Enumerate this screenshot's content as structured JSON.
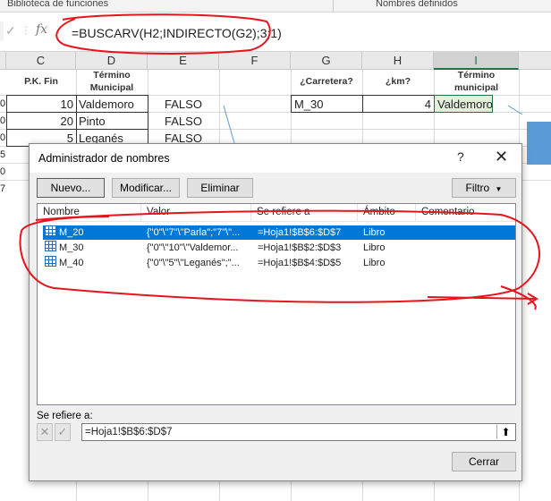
{
  "ribbon": {
    "group1": "Biblioteca de funciones",
    "group2": "Nombres definidos"
  },
  "formula_bar": {
    "cancel_icon": "x-icon",
    "confirm_icon": "check-icon",
    "fx": "fx",
    "formula": "=BUSCARV(H2;INDIRECTO(G2);3;1)"
  },
  "columns": [
    "C",
    "D",
    "E",
    "F",
    "G",
    "H",
    "I"
  ],
  "headers": {
    "c": "P.K. Fin",
    "d": "Término Municipal",
    "g": "¿Carretera?",
    "h": "¿km?",
    "i": "Término municipal"
  },
  "rows": [
    {
      "c": "10",
      "d": "Valdemoro",
      "e": "FALSO"
    },
    {
      "c": "20",
      "d": "Pinto",
      "e": "FALSO"
    },
    {
      "c": "5",
      "d": "Leganés",
      "e": "FALSO"
    }
  ],
  "lookup": {
    "g": "M_30",
    "h": "4",
    "i": "Valdemoro"
  },
  "left_edge_digits": [
    "0",
    "0",
    "0",
    "5",
    "0",
    "7"
  ],
  "dialog": {
    "title": "Administrador de nombres",
    "help": "?",
    "close": "✕",
    "btn_new": "Nuevo...",
    "btn_edit": "Modificar...",
    "btn_delete": "Eliminar",
    "btn_filter": "Filtro",
    "columns": {
      "name": "Nombre",
      "value": "Valor",
      "refers": "Se refiere a",
      "scope": "Ámbito",
      "comment": "Comentario"
    },
    "names": [
      {
        "name": "M_20",
        "value": "{\"0\"\\\"7\"\\\"Parla\";\"7\"\\\"...",
        "refers": "=Hoja1!$B$6:$D$7",
        "scope": "Libro"
      },
      {
        "name": "M_30",
        "value": "{\"0\"\\\"10\"\\\"Valdemor...",
        "refers": "=Hoja1!$B$2:$D$3",
        "scope": "Libro"
      },
      {
        "name": "M_40",
        "value": "{\"0\"\\\"5\"\\\"Leganés\";\"...",
        "refers": "=Hoja1!$B$4:$D$5",
        "scope": "Libro"
      }
    ],
    "refers_label": "Se refiere a:",
    "refers_value": "=Hoja1!$B$6:$D$7",
    "btn_close": "Cerrar"
  },
  "colors": {
    "accent": "#0078d7",
    "excel_green": "#217346",
    "ink": "#e8141c",
    "selected_cell": "#e2efda"
  }
}
